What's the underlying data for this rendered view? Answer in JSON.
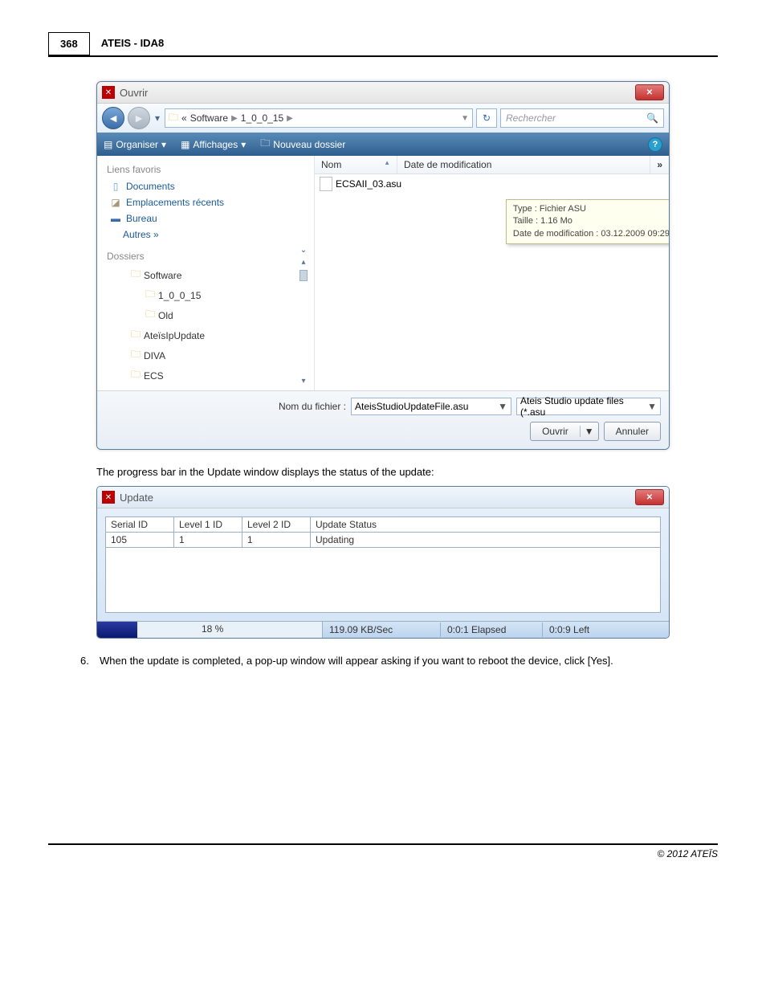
{
  "page": {
    "number": "368",
    "title": "ATEIS - IDA8",
    "footer": "© 2012 ATEÏS"
  },
  "open_dialog": {
    "window_title": "Ouvrir",
    "breadcrumb": {
      "prefix": "«",
      "seg1": "Software",
      "seg2": "1_0_0_15"
    },
    "search_placeholder": "Rechercher",
    "toolbar": {
      "organize": "Organiser",
      "views": "Affichages",
      "newfolder": "Nouveau dossier"
    },
    "sidebar": {
      "favorites_heading": "Liens favoris",
      "docs": "Documents",
      "recent": "Emplacements récents",
      "desktop": "Bureau",
      "others": "Autres  »",
      "folders_heading": "Dossiers",
      "tree": {
        "software": "Software",
        "v": "1_0_0_15",
        "old": "Old",
        "ateisip": "AteïsIpUpdate",
        "diva": "DIVA",
        "ecs": "ECS"
      }
    },
    "file_pane": {
      "col_name": "Nom",
      "col_date": "Date de modification",
      "more": "»",
      "file": "ECSAII_03.asu"
    },
    "tooltip": {
      "l1": "Type : Fichier ASU",
      "l2": "Taille : 1.16 Mo",
      "l3": "Date de modification : 03.12.2009 09:29"
    },
    "footer": {
      "fn_label": "Nom du fichier :",
      "fn_value": "AteisStudioUpdateFile.asu",
      "filter": "Ateis Studio update files (*.asu",
      "open": "Ouvrir",
      "cancel": "Annuler"
    }
  },
  "text": {
    "progress_caption": "The progress bar in the Update window displays the status of the update:",
    "step6": "When the update is completed, a pop-up window will appear asking if you want to reboot the device, click [Yes].",
    "step6_num": "6."
  },
  "update": {
    "title": "Update",
    "headers": {
      "c1": "Serial ID",
      "c2": "Level 1 ID",
      "c3": "Level 2 ID",
      "c4": "Update Status"
    },
    "row": {
      "c1": "105",
      "c2": "1",
      "c3": "1",
      "c4": "Updating"
    },
    "progress": "18 %",
    "rate": "119.09 KB/Sec",
    "elapsed": "0:0:1 Elapsed",
    "left": "0:0:9 Left"
  }
}
